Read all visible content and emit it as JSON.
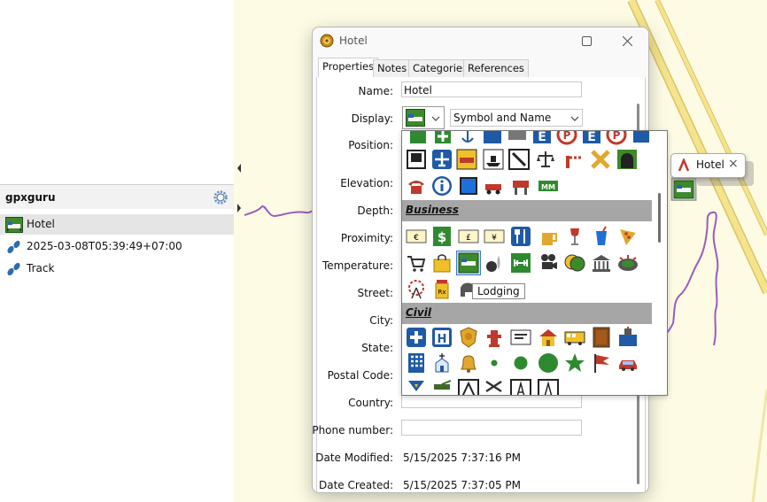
{
  "left_panel": {
    "title": "gpxguru",
    "items": [
      {
        "label": "Hotel",
        "icon": "lodging-icon",
        "selected": true
      },
      {
        "label": "2025-03-08T05:39:49+07:00",
        "icon": "footprints-icon",
        "selected": false
      },
      {
        "label": "Track",
        "icon": "footprints-icon",
        "selected": false
      }
    ]
  },
  "dialog": {
    "title": "Hotel",
    "tabs": [
      "Properties",
      "Notes",
      "Categories",
      "References"
    ],
    "active_tab": "Properties",
    "fields": {
      "name_label": "Name:",
      "name_value": "Hotel",
      "display_label": "Display:",
      "display_mode": "Symbol and Name",
      "position_label": "Position:",
      "elevation_label": "Elevation:",
      "depth_label": "Depth:",
      "proximity_label": "Proximity:",
      "temperature_label": "Temperature:",
      "street_label": "Street:",
      "city_label": "City:",
      "state_label": "State:",
      "postal_label": "Postal Code:",
      "country_label": "Country:",
      "phone_label": "Phone number:",
      "modified_label": "Date Modified:",
      "modified_value": "5/15/2025 7:37:16 PM",
      "created_label": "Date Created:",
      "created_value": "5/15/2025 7:37:05 PM"
    }
  },
  "symbol_picker": {
    "categories": [
      "Business",
      "Civil"
    ],
    "tooltip": "Lodging",
    "selected_symbol": "lodging"
  },
  "map_balloon": {
    "label": "Hotel",
    "close": "×"
  },
  "colors": {
    "map_bg": "#fdfbe3",
    "road": "#f2e08a",
    "track": "#9a5cc0",
    "category_header": "#a6a6a6",
    "selected_highlight": "#3a78d8"
  }
}
